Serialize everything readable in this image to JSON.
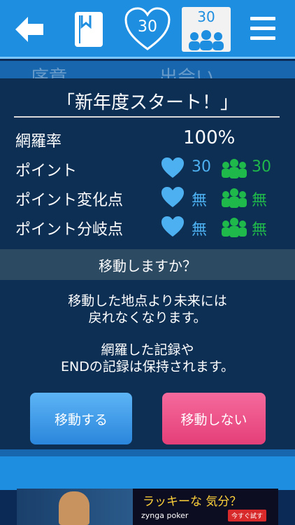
{
  "topbar": {
    "heart_count": "30",
    "people_count": "30"
  },
  "background": {
    "tab_left": "序章",
    "tab_right": "出会い"
  },
  "modal": {
    "title": "「新年度スタート！」",
    "coverage_label": "網羅率",
    "coverage_value": "100%",
    "points_label": "ポイント",
    "points_heart": "30",
    "points_people": "30",
    "change_label": "ポイント変化点",
    "change_heart": "無",
    "change_people": "無",
    "branch_label": "ポイント分岐点",
    "branch_heart": "無",
    "branch_people": "無",
    "question": "移動しますか？",
    "message_line1": "移動した地点より未来には",
    "message_line2": "戻れなくなります。",
    "message_line3": "網羅した記録や",
    "message_line4": "ENDの記録は保持されます。",
    "move_button": "移動する",
    "stay_button": "移動しない"
  },
  "ad": {
    "headline": "ラッキーな 気分？",
    "brand": "zynga poker",
    "cta": "今すぐ試す"
  },
  "colors": {
    "topbar": "#1e8ee0",
    "modal_bg": "#0d2f54",
    "heart_blue": "#4db0f0",
    "people_green": "#1fb84a",
    "move_button": "#3a97e6",
    "stay_button": "#ea4c84"
  }
}
